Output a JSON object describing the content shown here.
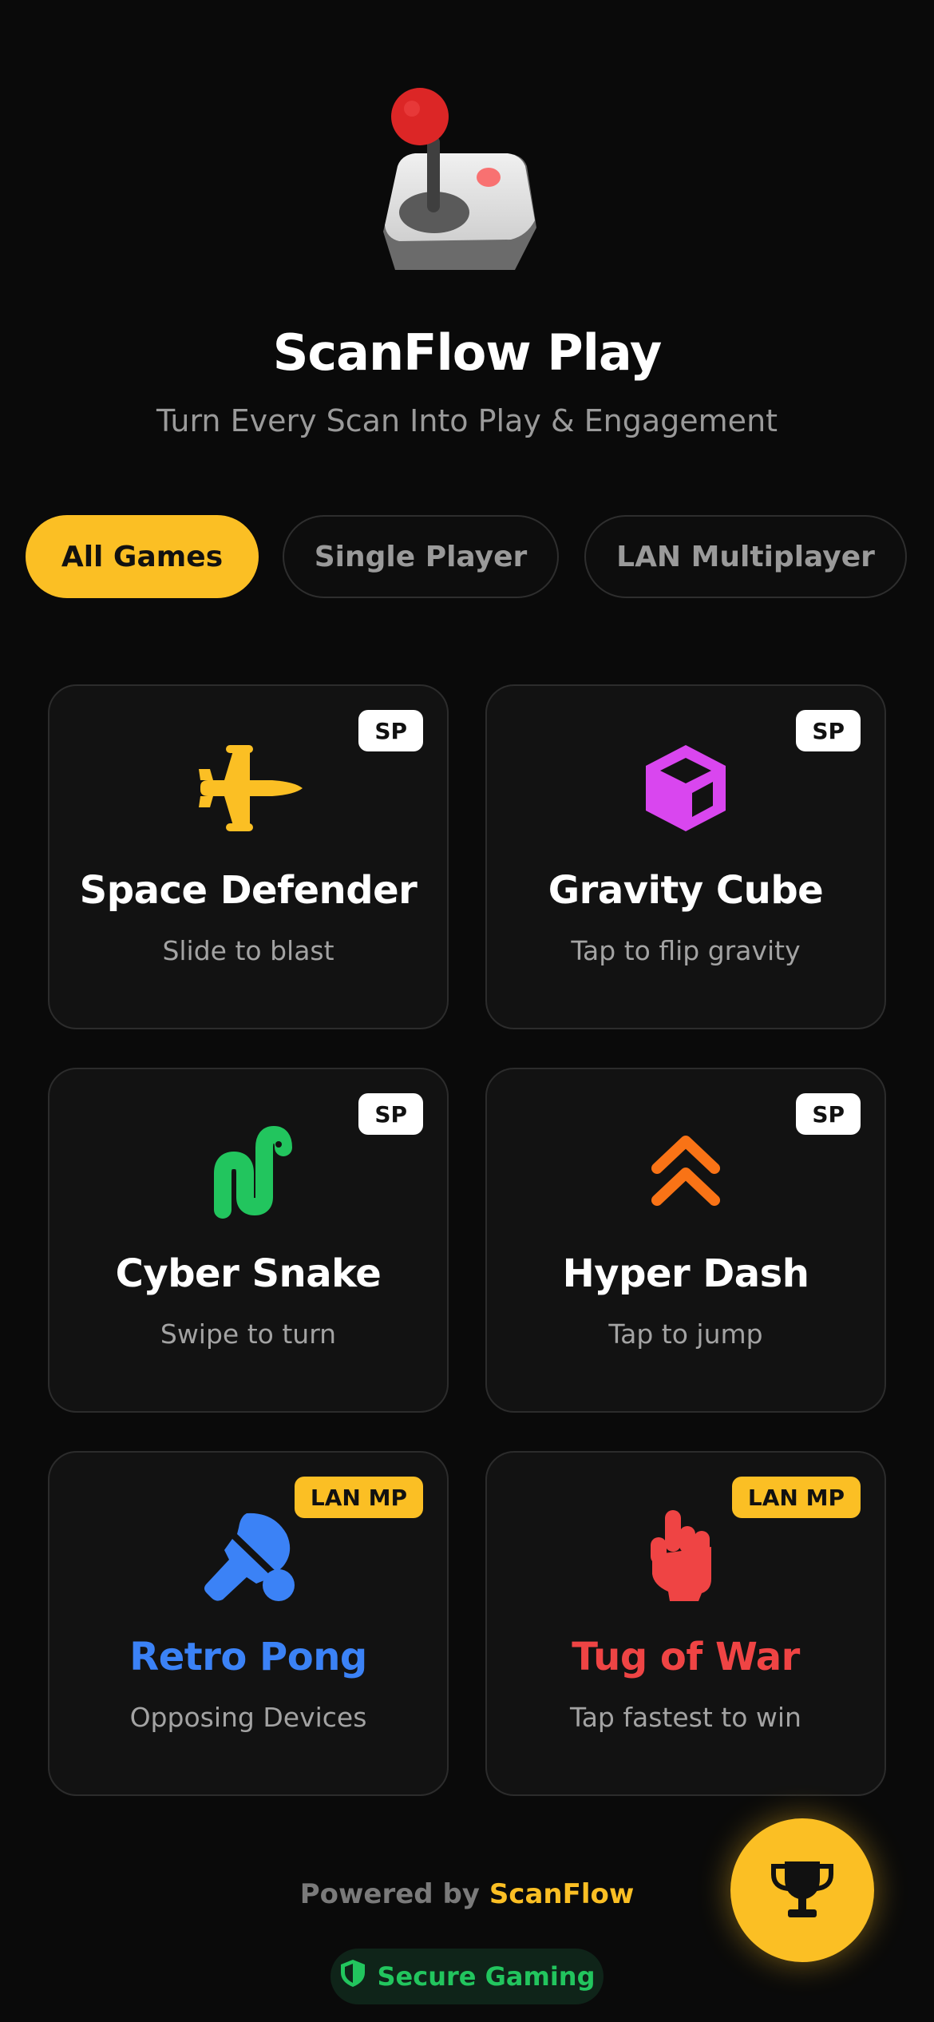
{
  "app": {
    "title": "ScanFlow Play",
    "subtitle": "Turn Every Scan Into Play & Engagement",
    "hero_icon": "joystick-icon"
  },
  "filters": [
    {
      "label": "All Games",
      "active": true
    },
    {
      "label": "Single Player",
      "active": false
    },
    {
      "label": "LAN Multiplayer",
      "active": false
    }
  ],
  "games": [
    {
      "title": "Space Defender",
      "subtitle": "Slide to blast",
      "badge": "SP",
      "icon": "fighter-jet-icon",
      "accent": "#fbbf24"
    },
    {
      "title": "Gravity Cube",
      "subtitle": "Tap to flip gravity",
      "badge": "SP",
      "icon": "cube-icon",
      "accent": "#d946ef"
    },
    {
      "title": "Cyber Snake",
      "subtitle": "Swipe to turn",
      "badge": "SP",
      "icon": "snake-icon",
      "accent": "#22c55e"
    },
    {
      "title": "Hyper Dash",
      "subtitle": "Tap to jump",
      "badge": "SP",
      "icon": "double-chevron-up-icon",
      "accent": "#f97316"
    },
    {
      "title": "Retro Pong",
      "subtitle": "Opposing Devices",
      "badge": "LAN MP",
      "icon": "ping-pong-paddle-icon",
      "accent": "#3b82f6"
    },
    {
      "title": "Tug of War",
      "subtitle": "Tap fastest to win",
      "badge": "LAN MP",
      "icon": "fist-icon",
      "accent": "#ef4444"
    }
  ],
  "footer": {
    "powered_prefix": "Powered by ",
    "powered_brand": "ScanFlow",
    "secure_label": "Secure Gaming",
    "secure_icon": "shield-icon"
  },
  "fab": {
    "icon": "trophy-icon"
  },
  "colors": {
    "accent": "#fbbf24",
    "background": "#0a0a0a",
    "card": "#121212"
  }
}
